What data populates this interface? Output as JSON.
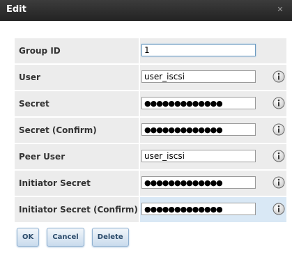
{
  "dialog": {
    "title": "Edit"
  },
  "form": {
    "rows": [
      {
        "label": "Group ID",
        "value": "1",
        "type": "text",
        "info": false,
        "focused": true
      },
      {
        "label": "User",
        "value": "user_iscsi",
        "type": "text",
        "info": true
      },
      {
        "label": "Secret",
        "value": "●●●●●●●●●●●●●",
        "type": "password",
        "info": true
      },
      {
        "label": "Secret (Confirm)",
        "value": "●●●●●●●●●●●●●",
        "type": "password",
        "info": true
      },
      {
        "label": "Peer User",
        "value": "user_iscsi",
        "type": "text",
        "info": true
      },
      {
        "label": "Initiator Secret",
        "value": "●●●●●●●●●●●●●",
        "type": "password",
        "info": true
      },
      {
        "label": "Initiator Secret (Confirm)",
        "value": "●●●●●●●●●●●●●",
        "type": "password",
        "info": true,
        "highlighted": true
      }
    ]
  },
  "buttons": {
    "ok": "OK",
    "cancel": "Cancel",
    "delete": "Delete"
  },
  "colors": {
    "titlebar": "#2d2d2d",
    "row_background": "#ececec",
    "highlight_background": "#d9e8f5",
    "button_text": "#2a4a6a"
  },
  "icons": {
    "close": "close-icon",
    "info": "info-icon"
  }
}
